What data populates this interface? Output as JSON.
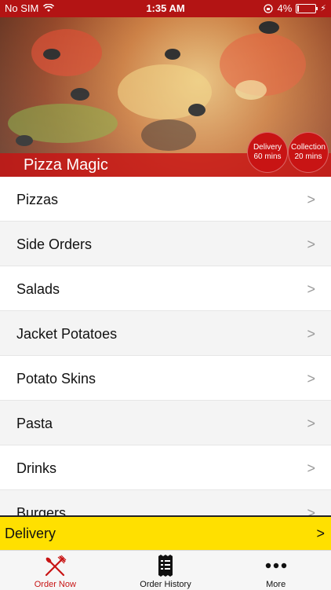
{
  "status_bar": {
    "carrier": "No SIM",
    "time": "1:35 AM",
    "battery": "4%"
  },
  "restaurant": {
    "name": "Pizza Magic",
    "delivery": {
      "label": "Delivery",
      "time": "60 mins"
    },
    "collection": {
      "label": "Collection",
      "time": "20 mins"
    }
  },
  "menu": {
    "categories": [
      {
        "label": "Pizzas"
      },
      {
        "label": "Side Orders"
      },
      {
        "label": "Salads"
      },
      {
        "label": "Jacket Potatoes"
      },
      {
        "label": "Potato Skins"
      },
      {
        "label": "Pasta"
      },
      {
        "label": "Drinks"
      },
      {
        "label": "Burgers"
      }
    ],
    "chevron": ">"
  },
  "order_mode": {
    "label": "Delivery",
    "arrow": ">"
  },
  "tabs": [
    {
      "label": "Order Now",
      "icon": "fork-knife-icon"
    },
    {
      "label": "Order History",
      "icon": "receipt-icon"
    },
    {
      "label": "More",
      "icon": "more-dots-icon"
    }
  ],
  "colors": {
    "brand_red": "#c81414",
    "delivery_yellow": "#ffe000"
  }
}
